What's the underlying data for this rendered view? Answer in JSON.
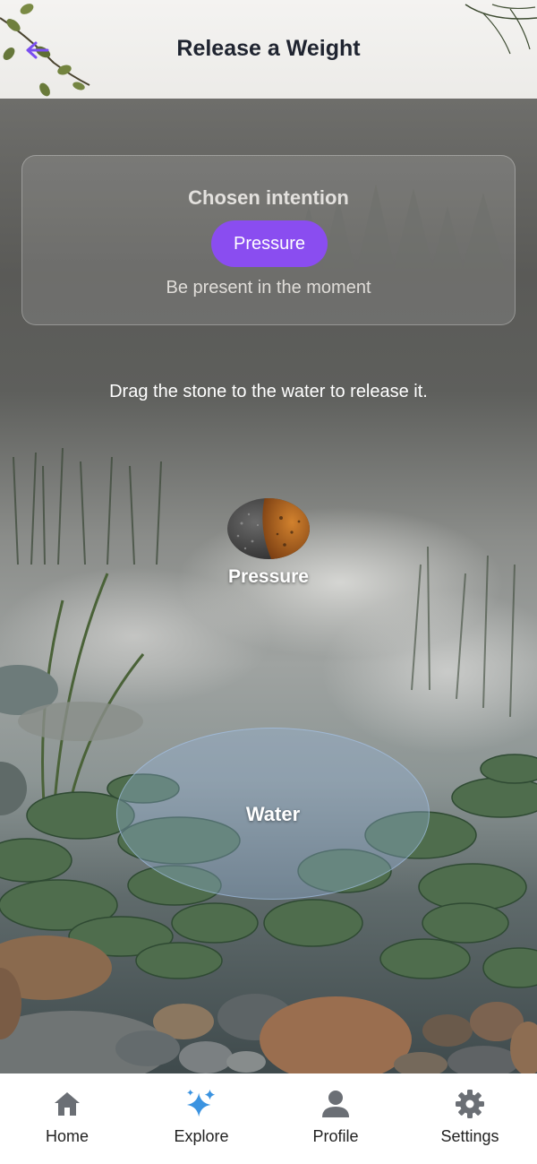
{
  "header": {
    "title": "Release a Weight",
    "back_icon": "arrow-left-icon"
  },
  "intention_card": {
    "heading": "Chosen intention",
    "selected_intention": "Pressure",
    "subtitle": "Be present in the moment"
  },
  "instruction": "Drag the stone to the water to release it.",
  "stone": {
    "label": "Pressure",
    "icon": "stone-icon"
  },
  "drop_zone": {
    "label": "Water"
  },
  "nav": {
    "items": [
      {
        "label": "Home",
        "icon": "home-icon"
      },
      {
        "label": "Explore",
        "icon": "sparkles-icon",
        "active": true
      },
      {
        "label": "Profile",
        "icon": "person-icon"
      },
      {
        "label": "Settings",
        "icon": "gear-icon"
      }
    ]
  },
  "colors": {
    "accent": "#8a4df0",
    "explore_icon": "#3b93e0",
    "nav_icon": "#6b6f75"
  }
}
